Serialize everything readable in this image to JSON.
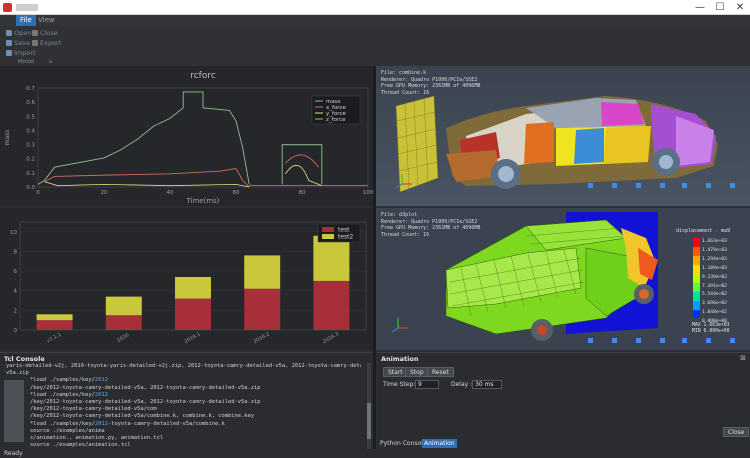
{
  "window": {
    "minimize": "—",
    "maximize": "☐",
    "close": "✕"
  },
  "menu": {
    "items": [
      "File",
      "View"
    ]
  },
  "toolbar": {
    "open": "Open",
    "close": "Close",
    "save": "Save",
    "export": "Export",
    "import": "Import",
    "group": "Model"
  },
  "plot1": {
    "title": "rcforc",
    "xlabel": "Time(ms)",
    "ylabel": "mass",
    "legend": [
      "mass",
      "x_force",
      "y_force",
      "z_force"
    ],
    "xticks": [
      "0",
      "20",
      "40",
      "60",
      "80",
      "100"
    ],
    "yticks": [
      "0.0",
      "0.1",
      "0.2",
      "0.3",
      "0.4",
      "0.5",
      "0.6",
      "0.7"
    ],
    "colors": {
      "mass": "#8fbf8f",
      "x_force": "#d06c5c",
      "y_force": "#e6e07a",
      "z_force": "#8fbf8f"
    }
  },
  "chart_data": {
    "type": "bar",
    "categories": [
      "v7.1.1",
      "2016",
      "2016.1",
      "2016.2",
      "2016.3"
    ],
    "series": [
      {
        "name": "test",
        "values": [
          1,
          1.5,
          3.2,
          4.2,
          5
        ]
      },
      {
        "name": "test2",
        "values": [
          0.6,
          1.9,
          2.2,
          3.4,
          4.6
        ]
      }
    ],
    "yticks": [
      "0",
      "2",
      "4",
      "6",
      "8",
      "10"
    ],
    "ylim": [
      0,
      11
    ],
    "colors": {
      "test": "#a72f3a",
      "test2": "#c9c83a"
    },
    "legend": "top-right"
  },
  "viewport1": {
    "info": [
      "File: combine.k",
      "Renderer: Quadro P1000/PCIe/SSE2",
      "Free GPU Memory: 2361MB of 4096MB",
      "Thread Count: 16"
    ]
  },
  "viewport2": {
    "info": [
      "File: d3plot",
      "Renderer: Quadro P1000/PCIe/SSE2",
      "Free GPU Memory: 2361MB of 4096MB",
      "Thread Count: 16"
    ],
    "legend_title": "displacement - ma9",
    "legend_values": [
      "1.663e+03",
      "1.479e+03",
      "1.294e+03",
      "1.109e+03",
      "9.239e+02",
      "7.391e+02",
      "5.544e+02",
      "3.696e+02",
      "1.848e+02",
      "0.000e+00"
    ],
    "max": "MAX 1.663e+03",
    "min": "MIN 0.000e+00"
  },
  "tcl": {
    "title": "Tcl Console",
    "lines": [
      "yaris-detailed-v2j, 2010-toyota-yaris-detailed-v2j.zip, 2012-toyota-camry-detailed-v5a, 2012-toyota-camry-detailed-v5a.zip",
      "v5a.zip",
      "*load ./samples/key/2012",
      "/key/2012-toyota-camry-detailed-v5a, 2012-toyota-camry-detailed-v5a.zip",
      "*load ./samples/key/2012",
      "/key/2012-toyota-camry-detailed-v5a, 2012-toyota-camry-detailed-v5a.zip",
      "/key/2012-toyota-camry-detailed-v5a/com",
      "/key/2012-toyota-camry-detailed-v5a/combine.k, combine.k, combine.key",
      "*load ./samples/key/2012-toyota-camry-detailed-v5a/combine.k",
      "source ./examples/anima",
      "s/animation., animation.py, animation.tcl",
      "source ./examples/animation.tcl"
    ]
  },
  "animation": {
    "title": "Animation",
    "start": "Start",
    "stop": "Stop",
    "reset": "Reset",
    "time_step_label": "Time Step:",
    "time_step_value": "9",
    "delay_label": "Delay :",
    "delay_value": "30 ms",
    "close": "Close",
    "tabs": [
      "Python Console",
      "Animation"
    ]
  },
  "status": "Ready"
}
